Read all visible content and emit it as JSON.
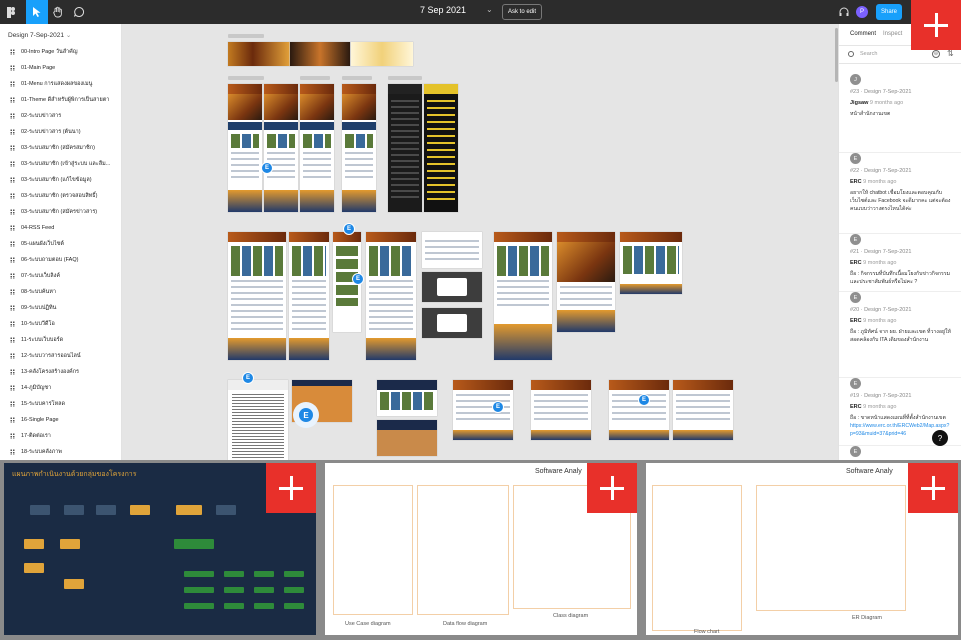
{
  "toolbar": {
    "title": "7 Sep 2021",
    "ask_to_edit": "Ask to edit",
    "avatar_initial": "P",
    "share": "Share"
  },
  "sidebar": {
    "page_header": "Design 7-Sep-2021",
    "pages": [
      "00-Intro Page วันสำคัญ",
      "01-Main Page",
      "01-Menu การแสดงผลของเมนู",
      "01-Theme ดีสำหรับผู้พิการเป็นสายตา",
      "02-ระบบข่าวสาร",
      "02-ระบบข่าวสาร (ต้นนา)",
      "03-ระบบสมาชิก (สมัครสมาชิก)",
      "03-ระบบสมาชิก (เข้าสู่ระบบ และลืม...",
      "03-ระบบสมาชิก (แก้ไขข้อมูล)",
      "03-ระบบสมาชิก (ตรวจสอบสิทธิ์)",
      "03-ระบบสมาชิก (สมัครข่าวสาร)",
      "04-RSS Feed",
      "05-แผนผังเว็บไซต์",
      "06-ระบบถามตอบ (FAQ)",
      "07-ระบบเว็บลิงค์",
      "08-ระบบค้นหา",
      "09-ระบบปฏิทิน",
      "10-ระบบวีดีโอ",
      "11-ระบบเว็บบอร์ด",
      "12-ระบบวารสารออนไลน์",
      "13-คลังโครงสร้างองค์กร",
      "14-ภูมิบัญชา",
      "15-ระบบคารโหลด",
      "16-Single Page",
      "17-ติดต่อเรา",
      "18-ระบบคลังภาพ"
    ]
  },
  "canvas": {
    "avatar_initial": "E"
  },
  "comments_panel": {
    "tabs": [
      "Comment",
      "Inspect"
    ],
    "search_placeholder": "Search",
    "comments": [
      {
        "initial": "J",
        "meta": "#23 · Design 7-Sep-2021",
        "author": "Jigsaw",
        "time": "9 months ago",
        "body": "หน้าสำนักงานเขต",
        "link": ""
      },
      {
        "initial": "E",
        "meta": "#22 · Design 7-Sep-2021",
        "author": "ERC",
        "time": "9 months ago",
        "body": "อยากให้ chatbot เชื่อมโยงและตอบคุณกับเว็บไซต์และ Facebook จะดีมากคะ แต่จะต้องคนแบบว่าวางตรงไหนได้ค่ะ",
        "link": ""
      },
      {
        "initial": "E",
        "meta": "#21 · Design 7-Sep-2021",
        "author": "ERC",
        "time": "9 months ago",
        "body": "ถือ : กิจกรรมที่บันทึกเนื้อมโยงกับข่าวกิจกรรมและประชาสัมพันธ์หรือไม่คะ ?",
        "link": ""
      },
      {
        "initial": "E",
        "meta": "#20 · Design 7-Sep-2021",
        "author": "ERC",
        "time": "9 months ago",
        "body": "ถือ : ภูมิทัศน์ จาก ผย. ฝ่ายและเขต ที่วางอยู่ให้สอดคล้องกับ ITA เดิมของสำนักงาน",
        "link": ""
      },
      {
        "initial": "E",
        "meta": "#19 · Design 7-Sep-2021",
        "author": "ERC",
        "time": "9 months ago",
        "body": "ถือ : ขาดหน้าแสดงแผนที่ที่ตั้งสำนักงานเขต",
        "link": "https://www.erc.or.th/ERCWeb2/Map.aspx?p=93&muid=37&prid=46"
      },
      {
        "initial": "E",
        "meta": "",
        "author": "",
        "time": "",
        "body": "",
        "link": ""
      }
    ],
    "help": "?"
  },
  "thumbnails": [
    {
      "title": "แผนภาพกำเนินงานด้วยกลุ่มของโครงการ"
    },
    {
      "title": "Software Analy",
      "labels": [
        "Use Case diagram",
        "Data flow diagram",
        "Class diagram"
      ]
    },
    {
      "title": "Software Analy",
      "labels": [
        "Flow chart",
        "ER Diagram"
      ]
    }
  ],
  "colors": {
    "accent": "#18a0fb",
    "badge_red": "#e8302a",
    "avatar_blue": "#1e88e5",
    "topbar": "#2c2c2c",
    "canvas": "#e5e5e5"
  }
}
